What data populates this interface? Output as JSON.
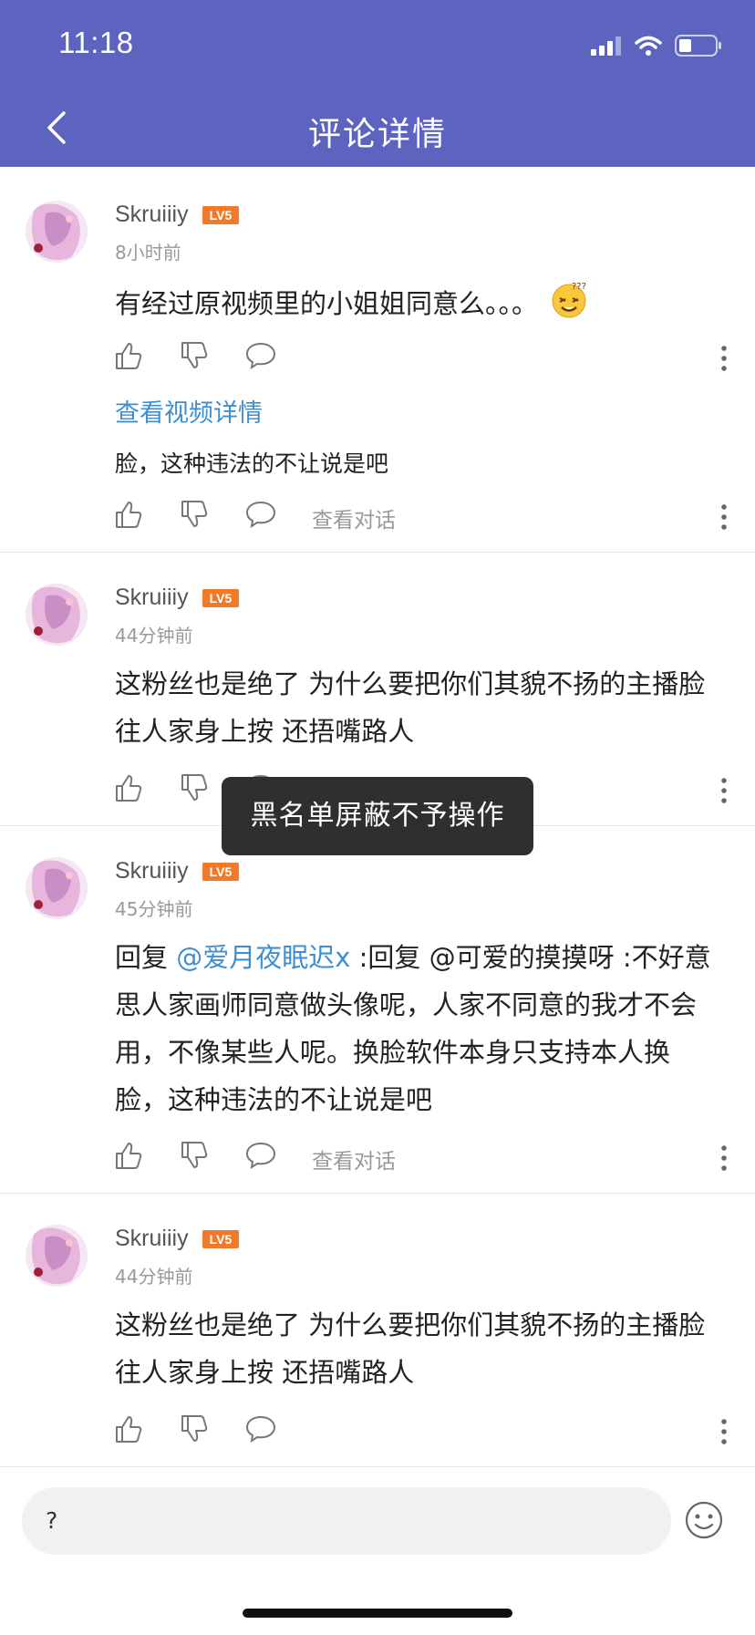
{
  "status_bar": {
    "time": "11:18"
  },
  "header": {
    "title": "评论详情"
  },
  "comments": [
    {
      "username": "Skruiiiy",
      "level": "LV5",
      "time": "8小时前",
      "text": "有经过原视频里的小姐姐同意么。。。",
      "link_label": "查看视频详情",
      "reply_preview": "脸，这种违法的不让说是吧",
      "conversation_label": "查看对话"
    },
    {
      "username": "Skruiiiy",
      "level": "LV5",
      "time": "44分钟前",
      "text_line1": "这粉丝也是绝了 为什么要把你们其貌不扬的主播脸",
      "text_line2": "往人家身上按 还捂嘴路人"
    },
    {
      "username": "Skruiiiy",
      "level": "LV5",
      "time": "45分钟前",
      "reply_prefix": "回复 ",
      "mention": "@爱月夜眠迟x",
      "line1_rest": " :回复 @可爱的摸摸呀 :不好意",
      "line2": "思人家画师同意做头像呢，人家不同意的我才不会",
      "line3": "用，不像某些人呢。换脸软件本身只支持本人换",
      "line4": "脸，这种违法的不让说是吧",
      "conversation_label": "查看对话"
    },
    {
      "username": "Skruiiiy",
      "level": "LV5",
      "time": "44分钟前",
      "text_line1": "这粉丝也是绝了 为什么要把你们其貌不扬的主播脸",
      "text_line2": "往人家身上按 还捂嘴路人"
    }
  ],
  "toast": {
    "message": "黑名单屏蔽不予操作"
  },
  "input": {
    "value": "?"
  },
  "colors": {
    "header_bg": "#5c64c0",
    "link": "#3f8fd0",
    "level_badge": "#f07a2a"
  },
  "icons": [
    "back-icon",
    "signal-icon",
    "wifi-icon",
    "battery-icon",
    "like-icon",
    "dislike-icon",
    "reply-icon",
    "more-icon",
    "emoji-icon"
  ]
}
